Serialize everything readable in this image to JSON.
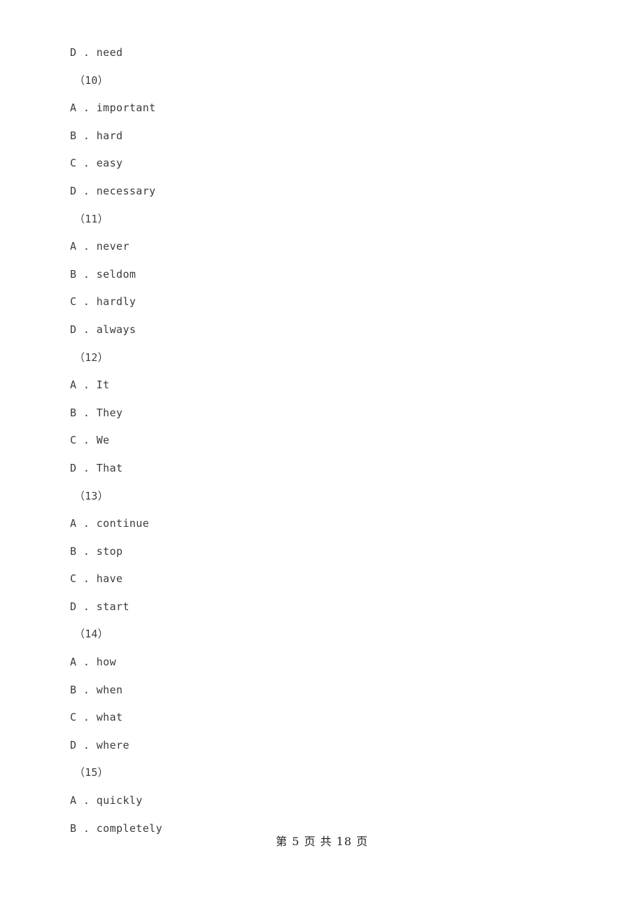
{
  "document": {
    "page_background": "#ffffff",
    "body_text_color": "#3c3c3c",
    "footer_text_color": "#1f1f1f"
  },
  "body_lines": [
    {
      "type": "option",
      "text": "D . need"
    },
    {
      "type": "qnum",
      "text": "（10）"
    },
    {
      "type": "option",
      "text": "A . important"
    },
    {
      "type": "option",
      "text": "B . hard"
    },
    {
      "type": "option",
      "text": "C . easy"
    },
    {
      "type": "option",
      "text": "D . necessary"
    },
    {
      "type": "qnum",
      "text": "（11）"
    },
    {
      "type": "option",
      "text": "A . never"
    },
    {
      "type": "option",
      "text": "B . seldom"
    },
    {
      "type": "option",
      "text": "C . hardly"
    },
    {
      "type": "option",
      "text": "D . always"
    },
    {
      "type": "qnum",
      "text": "（12）"
    },
    {
      "type": "option",
      "text": "A . It"
    },
    {
      "type": "option",
      "text": "B . They"
    },
    {
      "type": "option",
      "text": "C . We"
    },
    {
      "type": "option",
      "text": "D . That"
    },
    {
      "type": "qnum",
      "text": "（13）"
    },
    {
      "type": "option",
      "text": "A . continue"
    },
    {
      "type": "option",
      "text": "B . stop"
    },
    {
      "type": "option",
      "text": "C . have"
    },
    {
      "type": "option",
      "text": "D . start"
    },
    {
      "type": "qnum",
      "text": "（14）"
    },
    {
      "type": "option",
      "text": "A . how"
    },
    {
      "type": "option",
      "text": "B . when"
    },
    {
      "type": "option",
      "text": "C . what"
    },
    {
      "type": "option",
      "text": "D . where"
    },
    {
      "type": "qnum",
      "text": "（15）"
    },
    {
      "type": "option",
      "text": "A . quickly"
    },
    {
      "type": "option",
      "text": "B . completely"
    }
  ],
  "footer": {
    "text": "第 5 页 共 18 页",
    "page_number": 5,
    "total_pages": 18
  }
}
